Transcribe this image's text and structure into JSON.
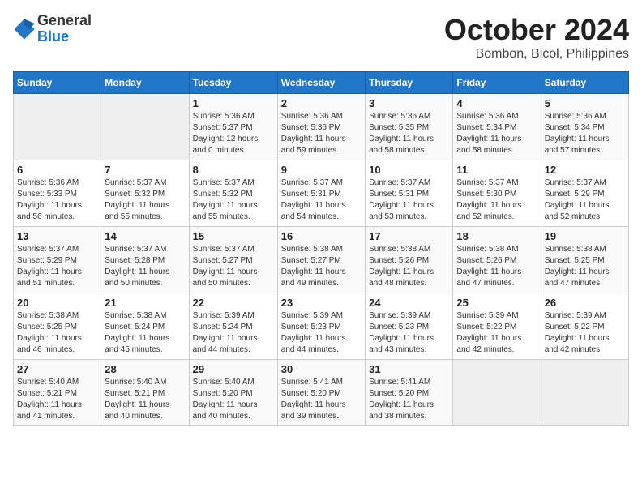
{
  "logo": {
    "general": "General",
    "blue": "Blue"
  },
  "title": "October 2024",
  "subtitle": "Bombon, Bicol, Philippines",
  "headers": [
    "Sunday",
    "Monday",
    "Tuesday",
    "Wednesday",
    "Thursday",
    "Friday",
    "Saturday"
  ],
  "weeks": [
    [
      {
        "day": "",
        "info": ""
      },
      {
        "day": "",
        "info": ""
      },
      {
        "day": "1",
        "info": "Sunrise: 5:36 AM\nSunset: 5:37 PM\nDaylight: 12 hours\nand 0 minutes."
      },
      {
        "day": "2",
        "info": "Sunrise: 5:36 AM\nSunset: 5:36 PM\nDaylight: 11 hours\nand 59 minutes."
      },
      {
        "day": "3",
        "info": "Sunrise: 5:36 AM\nSunset: 5:35 PM\nDaylight: 11 hours\nand 58 minutes."
      },
      {
        "day": "4",
        "info": "Sunrise: 5:36 AM\nSunset: 5:34 PM\nDaylight: 11 hours\nand 58 minutes."
      },
      {
        "day": "5",
        "info": "Sunrise: 5:36 AM\nSunset: 5:34 PM\nDaylight: 11 hours\nand 57 minutes."
      }
    ],
    [
      {
        "day": "6",
        "info": "Sunrise: 5:36 AM\nSunset: 5:33 PM\nDaylight: 11 hours\nand 56 minutes."
      },
      {
        "day": "7",
        "info": "Sunrise: 5:37 AM\nSunset: 5:32 PM\nDaylight: 11 hours\nand 55 minutes."
      },
      {
        "day": "8",
        "info": "Sunrise: 5:37 AM\nSunset: 5:32 PM\nDaylight: 11 hours\nand 55 minutes."
      },
      {
        "day": "9",
        "info": "Sunrise: 5:37 AM\nSunset: 5:31 PM\nDaylight: 11 hours\nand 54 minutes."
      },
      {
        "day": "10",
        "info": "Sunrise: 5:37 AM\nSunset: 5:31 PM\nDaylight: 11 hours\nand 53 minutes."
      },
      {
        "day": "11",
        "info": "Sunrise: 5:37 AM\nSunset: 5:30 PM\nDaylight: 11 hours\nand 52 minutes."
      },
      {
        "day": "12",
        "info": "Sunrise: 5:37 AM\nSunset: 5:29 PM\nDaylight: 11 hours\nand 52 minutes."
      }
    ],
    [
      {
        "day": "13",
        "info": "Sunrise: 5:37 AM\nSunset: 5:29 PM\nDaylight: 11 hours\nand 51 minutes."
      },
      {
        "day": "14",
        "info": "Sunrise: 5:37 AM\nSunset: 5:28 PM\nDaylight: 11 hours\nand 50 minutes."
      },
      {
        "day": "15",
        "info": "Sunrise: 5:37 AM\nSunset: 5:27 PM\nDaylight: 11 hours\nand 50 minutes."
      },
      {
        "day": "16",
        "info": "Sunrise: 5:38 AM\nSunset: 5:27 PM\nDaylight: 11 hours\nand 49 minutes."
      },
      {
        "day": "17",
        "info": "Sunrise: 5:38 AM\nSunset: 5:26 PM\nDaylight: 11 hours\nand 48 minutes."
      },
      {
        "day": "18",
        "info": "Sunrise: 5:38 AM\nSunset: 5:26 PM\nDaylight: 11 hours\nand 47 minutes."
      },
      {
        "day": "19",
        "info": "Sunrise: 5:38 AM\nSunset: 5:25 PM\nDaylight: 11 hours\nand 47 minutes."
      }
    ],
    [
      {
        "day": "20",
        "info": "Sunrise: 5:38 AM\nSunset: 5:25 PM\nDaylight: 11 hours\nand 46 minutes."
      },
      {
        "day": "21",
        "info": "Sunrise: 5:38 AM\nSunset: 5:24 PM\nDaylight: 11 hours\nand 45 minutes."
      },
      {
        "day": "22",
        "info": "Sunrise: 5:39 AM\nSunset: 5:24 PM\nDaylight: 11 hours\nand 44 minutes."
      },
      {
        "day": "23",
        "info": "Sunrise: 5:39 AM\nSunset: 5:23 PM\nDaylight: 11 hours\nand 44 minutes."
      },
      {
        "day": "24",
        "info": "Sunrise: 5:39 AM\nSunset: 5:23 PM\nDaylight: 11 hours\nand 43 minutes."
      },
      {
        "day": "25",
        "info": "Sunrise: 5:39 AM\nSunset: 5:22 PM\nDaylight: 11 hours\nand 42 minutes."
      },
      {
        "day": "26",
        "info": "Sunrise: 5:39 AM\nSunset: 5:22 PM\nDaylight: 11 hours\nand 42 minutes."
      }
    ],
    [
      {
        "day": "27",
        "info": "Sunrise: 5:40 AM\nSunset: 5:21 PM\nDaylight: 11 hours\nand 41 minutes."
      },
      {
        "day": "28",
        "info": "Sunrise: 5:40 AM\nSunset: 5:21 PM\nDaylight: 11 hours\nand 40 minutes."
      },
      {
        "day": "29",
        "info": "Sunrise: 5:40 AM\nSunset: 5:20 PM\nDaylight: 11 hours\nand 40 minutes."
      },
      {
        "day": "30",
        "info": "Sunrise: 5:41 AM\nSunset: 5:20 PM\nDaylight: 11 hours\nand 39 minutes."
      },
      {
        "day": "31",
        "info": "Sunrise: 5:41 AM\nSunset: 5:20 PM\nDaylight: 11 hours\nand 38 minutes."
      },
      {
        "day": "",
        "info": ""
      },
      {
        "day": "",
        "info": ""
      }
    ]
  ]
}
